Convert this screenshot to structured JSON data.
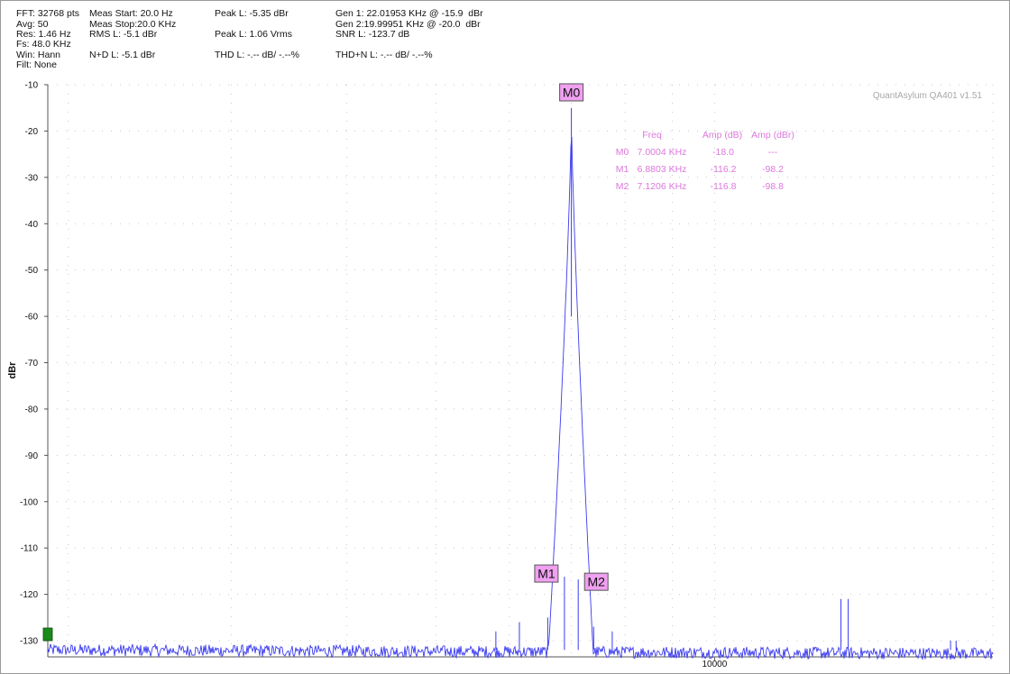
{
  "stats": {
    "fft": "FFT: 32768 pts",
    "avg": "Avg: 50",
    "res": "Res: 1.46 Hz",
    "fs": "Fs: 48.0 KHz",
    "win": "Win: Hann",
    "filt": "Filt: None",
    "meas_start": "Meas Start: 20.0 Hz",
    "meas_stop": "Meas Stop:20.0 KHz",
    "rms": "RMS L: -5.1 dBr",
    "nd": "N+D L: -5.1 dBr",
    "peak_dbr": "Peak L: -5.35 dBr",
    "peak_vrms": "Peak L: 1.06 Vrms",
    "thd": "THD L: -.-- dB/ -.--%",
    "gen1": "Gen 1: 22.01953 KHz @ -15.9  dBr",
    "gen2": "Gen 2:19.99951 KHz @ -20.0  dBr",
    "snr": "SNR L: -123.7 dB",
    "thdn": "THD+N L: -.-- dB/ -.--%"
  },
  "watermark": "QuantAsylum QA401 v1.51",
  "marker_table": {
    "headers": [
      "Freq",
      "Amp (dB)",
      "Amp (dBr)"
    ],
    "rows": [
      {
        "name": "M0",
        "freq": "7.0004 KHz",
        "amp_db": "-18.0",
        "amp_dbr": "---"
      },
      {
        "name": "M1",
        "freq": "6.8803 KHz",
        "amp_db": "-116.2",
        "amp_dbr": "-98.2"
      },
      {
        "name": "M2",
        "freq": "7.1206 KHz",
        "amp_db": "-116.8",
        "amp_dbr": "-98.8"
      }
    ]
  },
  "colors": {
    "trace": "#3a3af0",
    "marker_bg": "#f0a0f0",
    "marker_table": "#dc78dc",
    "grid": "#c8c8c8",
    "ref_marker": "#1a8a1a"
  },
  "chart_data": {
    "type": "line",
    "title": "",
    "xlabel": "",
    "ylabel": "dBr",
    "x_scale": "log",
    "xlim": [
      1900,
      20000
    ],
    "ylim": [
      -133.5,
      -10
    ],
    "x_tick_labels": [
      "10000"
    ],
    "y_ticks": [
      -10,
      -20,
      -30,
      -40,
      -50,
      -60,
      -70,
      -80,
      -90,
      -100,
      -110,
      -120,
      -130
    ],
    "grid": true,
    "noise_floor_dbr": -132,
    "peak": {
      "freq_hz": 7000.4,
      "level_dbr": -17
    },
    "spurs": [
      {
        "freq_hz": 5800,
        "level_dbr": -128
      },
      {
        "freq_hz": 6150,
        "level_dbr": -126
      },
      {
        "freq_hz": 6600,
        "level_dbr": -125
      },
      {
        "freq_hz": 6880.3,
        "level_dbr": -116.2
      },
      {
        "freq_hz": 7120.6,
        "level_dbr": -116.8
      },
      {
        "freq_hz": 7400,
        "level_dbr": -127
      },
      {
        "freq_hz": 7750,
        "level_dbr": -128
      },
      {
        "freq_hz": 13700,
        "level_dbr": -121
      },
      {
        "freq_hz": 13950,
        "level_dbr": -121
      },
      {
        "freq_hz": 18000,
        "level_dbr": -130
      },
      {
        "freq_hz": 18250,
        "level_dbr": -130
      }
    ],
    "markers": [
      {
        "name": "M0",
        "freq_hz": 7000.4,
        "level_dbr": -17
      },
      {
        "name": "M1",
        "freq_hz": 6880.3,
        "level_dbr": -116.2
      },
      {
        "name": "M2",
        "freq_hz": 7120.6,
        "level_dbr": -116.8
      }
    ]
  }
}
